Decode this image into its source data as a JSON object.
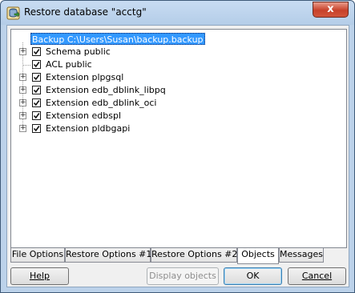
{
  "window": {
    "title": "Restore database \"acctg\"",
    "close_glyph": "x"
  },
  "tree": {
    "root": "Backup C:\\Users\\Susan\\backup.backup",
    "items": [
      {
        "label": "Schema public",
        "expandable": true,
        "checked": true
      },
      {
        "label": "ACL public",
        "expandable": false,
        "checked": true
      },
      {
        "label": "Extension plpgsql",
        "expandable": true,
        "checked": true
      },
      {
        "label": "Extension edb_dblink_libpq",
        "expandable": true,
        "checked": true
      },
      {
        "label": "Extension edb_dblink_oci",
        "expandable": true,
        "checked": true
      },
      {
        "label": "Extension edbspl",
        "expandable": true,
        "checked": true
      },
      {
        "label": "Extension pldbgapi",
        "expandable": true,
        "checked": true
      }
    ]
  },
  "tabs": [
    {
      "label": "File Options",
      "active": false
    },
    {
      "label": "Restore Options #1",
      "active": false
    },
    {
      "label": "Restore Options #2",
      "active": false
    },
    {
      "label": "Objects",
      "active": true
    },
    {
      "label": "Messages",
      "active": false
    }
  ],
  "buttons": {
    "help": "Help",
    "display_objects": "Display objects",
    "ok": "OK",
    "cancel": "Cancel"
  },
  "colors": {
    "selection": "#3399ff",
    "titlebar": "#bcd2ea",
    "close_button": "#c7412a"
  }
}
